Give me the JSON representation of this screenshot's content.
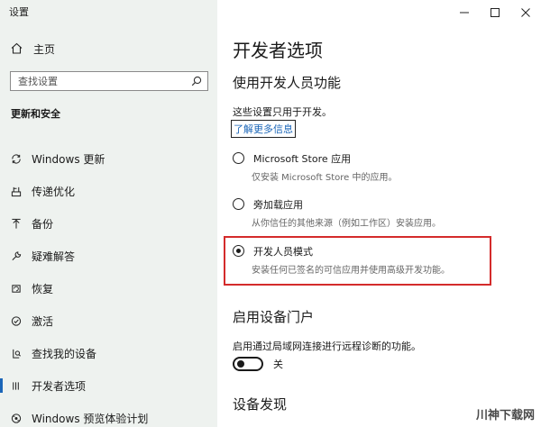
{
  "window": {
    "title": "设置"
  },
  "sidebar": {
    "home_label": "主页",
    "search_placeholder": "查找设置",
    "section_title": "更新和安全",
    "items": [
      {
        "label": "Windows 更新",
        "icon": "sync-icon"
      },
      {
        "label": "传递优化",
        "icon": "delivery-optimization-icon"
      },
      {
        "label": "备份",
        "icon": "backup-icon"
      },
      {
        "label": "疑难解答",
        "icon": "wrench-icon"
      },
      {
        "label": "恢复",
        "icon": "recovery-icon"
      },
      {
        "label": "激活",
        "icon": "activation-icon"
      },
      {
        "label": "查找我的设备",
        "icon": "find-device-icon"
      },
      {
        "label": "开发者选项",
        "icon": "developer-icon",
        "active": true
      },
      {
        "label": "Windows 预览体验计划",
        "icon": "insider-icon"
      }
    ]
  },
  "main": {
    "title": "开发者选项",
    "dev_features": {
      "heading": "使用开发人员功能",
      "description": "这些设置只用于开发。",
      "link": "了解更多信息",
      "options": [
        {
          "label": "Microsoft Store 应用",
          "hint": "仅安装 Microsoft Store 中的应用。",
          "selected": false
        },
        {
          "label": "旁加载应用",
          "hint": "从你信任的其他来源（例如工作区）安装应用。",
          "selected": false
        },
        {
          "label": "开发人员模式",
          "hint": "安装任何已签名的可信应用并使用高级开发功能。",
          "selected": true
        }
      ]
    },
    "device_portal": {
      "heading": "启用设备门户",
      "description": "启用通过局域网连接进行远程诊断的功能。",
      "toggle_label": "关",
      "toggle_on": false
    },
    "device_discovery": {
      "heading": "设备发现"
    }
  },
  "watermark": "川神下载网",
  "colors": {
    "accent": "#1b66b8",
    "highlight_border": "#d42b2b",
    "sidebar_bg": "#eef2ef"
  }
}
